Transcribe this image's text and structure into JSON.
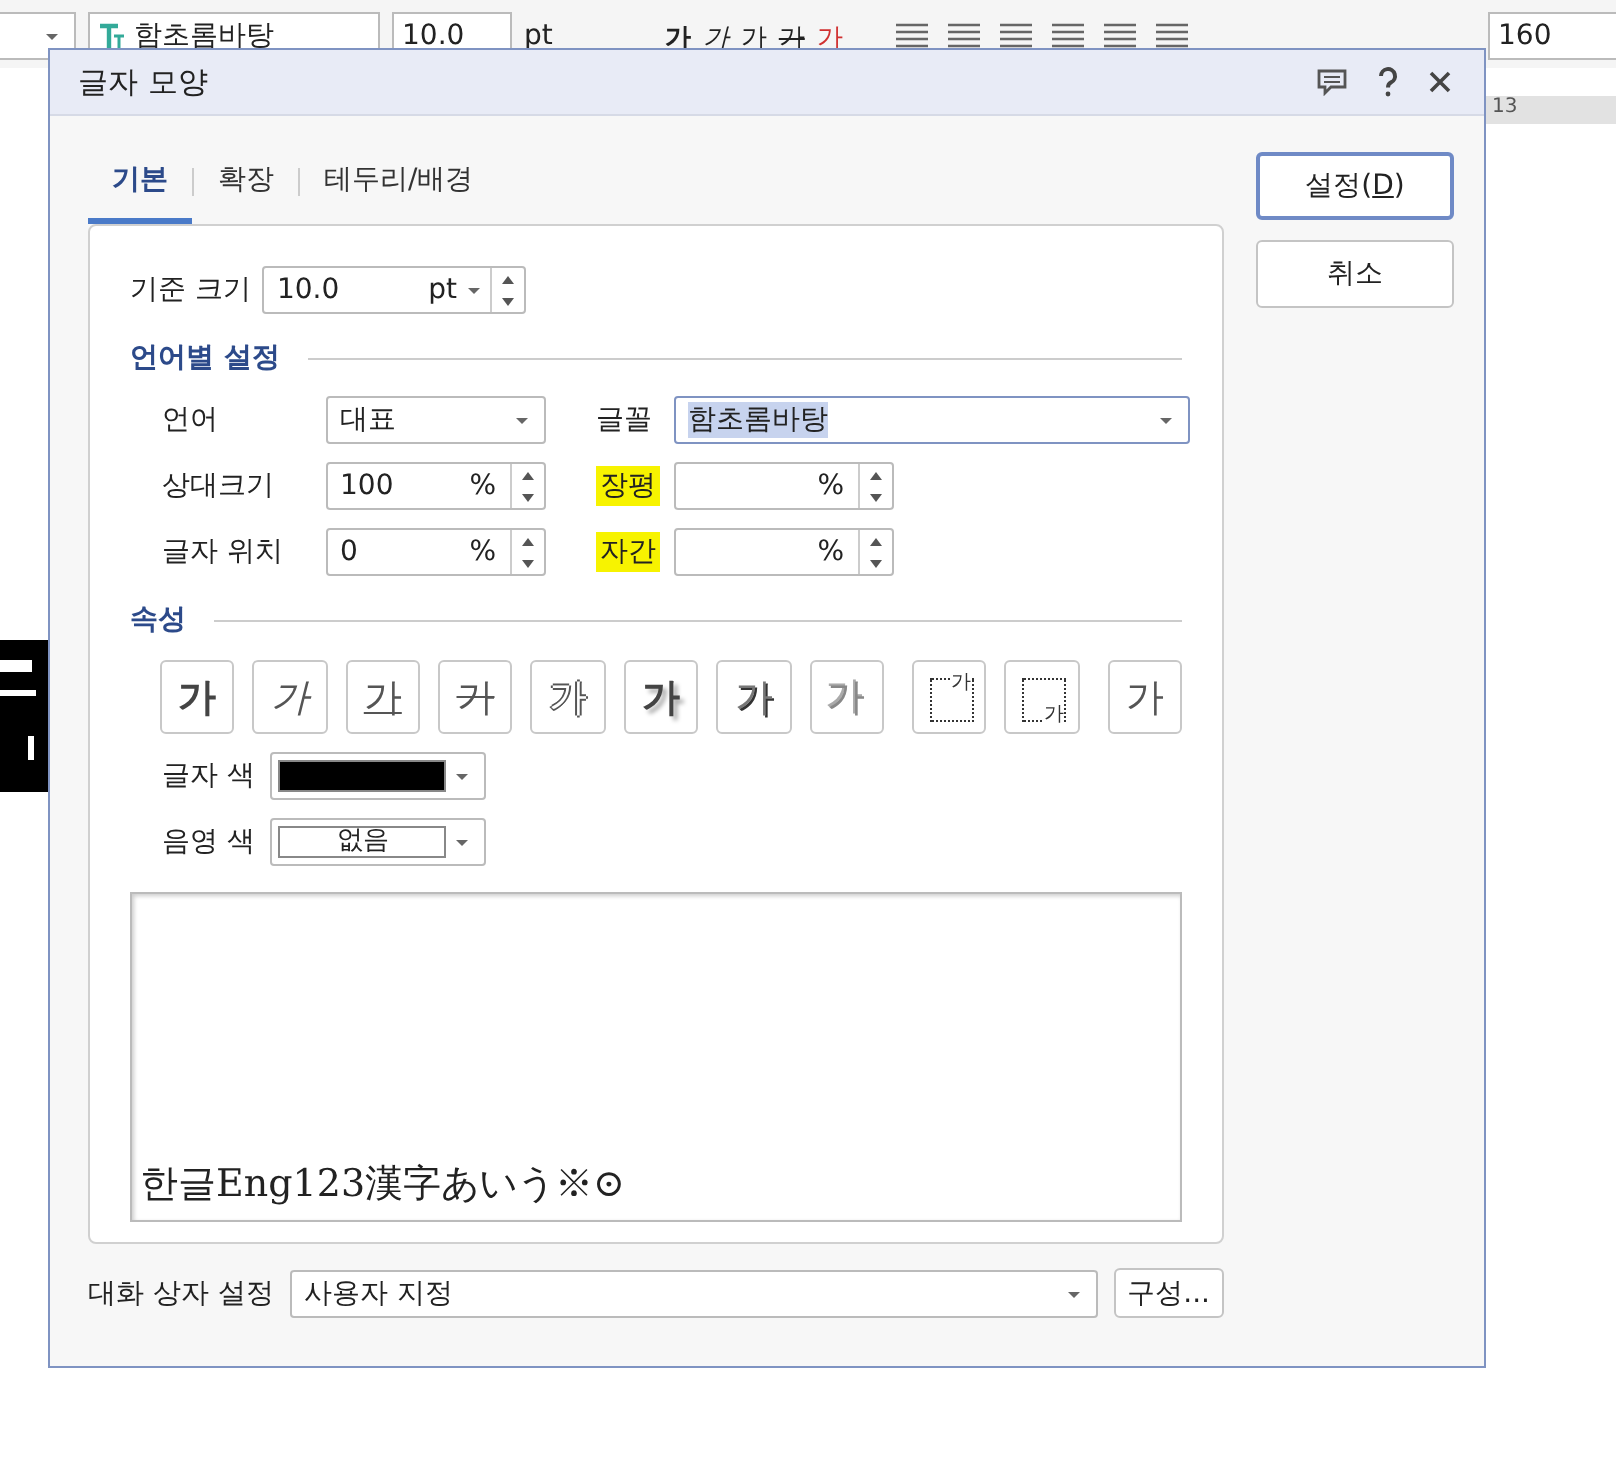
{
  "toolbar": {
    "font": "함초롬바탕",
    "size": "10.0",
    "unit": "pt",
    "style_buttons": [
      {
        "label": "가",
        "kind": "bold"
      },
      {
        "label": "가",
        "kind": "italic"
      },
      {
        "label": "가",
        "kind": "underline"
      },
      {
        "label": "가",
        "kind": "strike"
      },
      {
        "label": "가",
        "kind": "color",
        "color": "#d03030"
      }
    ],
    "line_spacing": "160"
  },
  "ruler": {
    "mark": "13"
  },
  "dialog": {
    "title": "글자 모양",
    "tabs": [
      {
        "label": "기본",
        "selected": true
      },
      {
        "label": "확장",
        "selected": false
      },
      {
        "label": "테두리/배경",
        "selected": false
      }
    ],
    "base_size": {
      "label": "기준 크기",
      "value": "10.0",
      "unit": "pt"
    },
    "language_section": {
      "title": "언어별 설정",
      "language": {
        "label": "언어",
        "value": "대표"
      },
      "font": {
        "label": "글꼴",
        "value": "함초롬바탕",
        "text_selected": true
      },
      "relative_size": {
        "label": "상대크기",
        "value": "100",
        "unit": "%"
      },
      "width_ratio": {
        "label": "장평",
        "unit": "%",
        "highlighted": true
      },
      "position": {
        "label": "글자 위치",
        "value": "0",
        "unit": "%"
      },
      "spacing": {
        "label": "자간",
        "unit": "%",
        "highlighted": true
      }
    },
    "attributes_section": {
      "title": "속성",
      "buttons": [
        {
          "label": "가",
          "kind": "bold"
        },
        {
          "label": "가",
          "kind": "italic"
        },
        {
          "label": "가",
          "kind": "underline"
        },
        {
          "label": "가",
          "kind": "strike"
        },
        {
          "label": "가",
          "kind": "outline"
        },
        {
          "label": "가",
          "kind": "shadow"
        },
        {
          "label": "가",
          "kind": "emboss"
        },
        {
          "label": "가",
          "kind": "engrave"
        },
        {
          "label": "가",
          "kind": "superscript"
        },
        {
          "label": "가",
          "kind": "subscript"
        },
        {
          "label": "가",
          "kind": "normal"
        }
      ],
      "text_color": {
        "label": "글자 색",
        "color": "#000000"
      },
      "shade_color": {
        "label": "음영 색",
        "value": "없음"
      }
    },
    "preview": "한글Eng123漢字あいう※⊙",
    "dialog_setting": {
      "label": "대화 상자 설정",
      "value": "사용자 지정"
    },
    "configure_button": "구성...",
    "side_buttons": [
      {
        "label_before": "설정(",
        "mnemonic": "D",
        "label_after": ")",
        "default": true
      },
      {
        "label_before": "취소",
        "default": false
      }
    ]
  }
}
